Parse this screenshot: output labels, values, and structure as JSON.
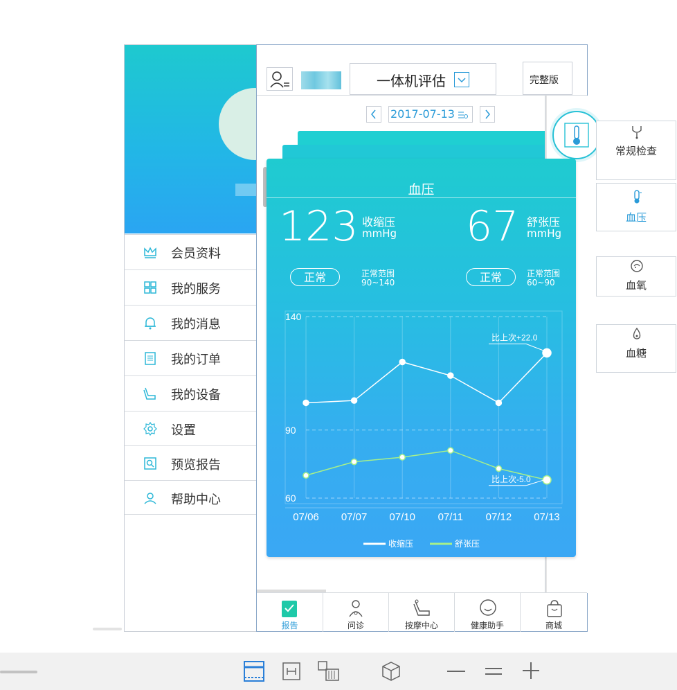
{
  "member_menu": {
    "items": [
      {
        "label": "会员资料",
        "icon": "crown-icon"
      },
      {
        "label": "我的服务",
        "icon": "grid-icon"
      },
      {
        "label": "我的消息",
        "icon": "bell-icon"
      },
      {
        "label": "我的订单",
        "icon": "clipboard-icon"
      },
      {
        "label": "我的设备",
        "icon": "massage-chair-icon"
      },
      {
        "label": "设置",
        "icon": "gear-icon"
      },
      {
        "label": "预览报告",
        "icon": "report-search-icon"
      },
      {
        "label": "帮助中心",
        "icon": "support-person-icon"
      }
    ]
  },
  "header": {
    "dropdown_value": "一体机评估",
    "full_version_button": "完整版"
  },
  "date_nav": {
    "date": "2017-07-13"
  },
  "right_menu": {
    "items": [
      {
        "label": "常规检查",
        "icon": "stethoscope-icon"
      },
      {
        "label": "血压",
        "icon": "thermometer-icon",
        "active": true
      },
      {
        "label": "血氧",
        "icon": "oxygen-icon"
      },
      {
        "label": "血糖",
        "icon": "blood-drop-icon"
      }
    ]
  },
  "bp_card": {
    "title": "血压",
    "systolic": {
      "value": "123",
      "label": "收缩压",
      "unit": "mmHg",
      "status": "正常",
      "range_label": "正常范围",
      "range": "90~140"
    },
    "diastolic": {
      "value": "67",
      "label": "舒张压",
      "unit": "mmHg",
      "status": "正常",
      "range_label": "正常范围",
      "range": "60~90"
    }
  },
  "chart_data": {
    "type": "line",
    "categories": [
      "07/06",
      "07/07",
      "07/10",
      "07/11",
      "07/12",
      "07/13"
    ],
    "y_ticks": [
      "140",
      "90",
      "60"
    ],
    "ylim": [
      60,
      140
    ],
    "series": [
      {
        "name": "收缩压",
        "values": [
          102,
          103,
          120,
          114,
          102,
          124
        ],
        "color": "#ffffff"
      },
      {
        "name": "舒张压",
        "values": [
          70,
          76,
          78,
          81,
          73,
          68
        ],
        "color": "#a6f08a"
      }
    ],
    "annotations": [
      {
        "text": "比上次+22.0",
        "series": "收缩压"
      },
      {
        "text": "比上次-5.0",
        "series": "舒张压"
      }
    ],
    "legend": [
      "收缩压",
      "舒张压"
    ],
    "legend_position": "bottom",
    "grid": true
  },
  "tabbar": {
    "items": [
      {
        "label": "报告",
        "icon": "report-icon",
        "active": true
      },
      {
        "label": "问诊",
        "icon": "doctor-icon"
      },
      {
        "label": "按摩中心",
        "icon": "massage-chair-icon"
      },
      {
        "label": "健康助手",
        "icon": "chat-icon"
      },
      {
        "label": "商城",
        "icon": "shopping-bag-icon"
      }
    ]
  },
  "colors": {
    "accent": "#1ec9cf",
    "tab_active": "#2a9bd8",
    "card_top": "#1fcbd0",
    "card_bottom": "#3aa7f4"
  }
}
